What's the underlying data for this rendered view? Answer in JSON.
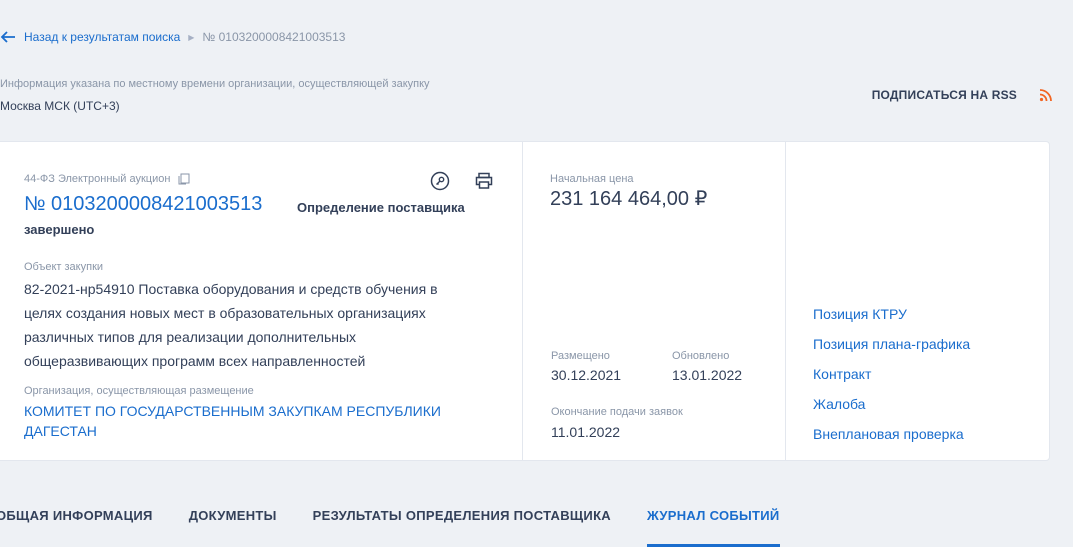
{
  "breadcrumb": {
    "back_label": "Назад к результатам поиска",
    "current": "№ 0103200008421003513"
  },
  "timezone": {
    "note": "Информация указана по местному времени организации, осуществляющей закупку",
    "value": "Москва МСК (UTC+3)"
  },
  "rss": {
    "label": "ПОДПИСАТЬСЯ НА RSS",
    "icon": "rss-icon",
    "color": "#f26522"
  },
  "card": {
    "law": "44-ФЗ Электронный аукцион",
    "reg_number": "№ 0103200008421003513",
    "status_line1": "Определение поставщика",
    "status_line2": "завершено",
    "object_label": "Объект закупки",
    "object_text": "82-2021-нр54910 Поставка оборудования и средств обучения в целях создания новых мест в образовательных организациях различных типов для реализации дополнительных общеразвивающих программ всех направленностей",
    "org_label": "Организация, осуществляющая размещение",
    "org_name": "КОМИТЕТ ПО ГОСУДАРСТВЕННЫМ ЗАКУПКАМ РЕСПУБЛИКИ ДАГЕСТАН",
    "price_label": "Начальная цена",
    "price": "231 164 464,00 ₽",
    "placed_label": "Размещено",
    "placed_date": "30.12.2021",
    "updated_label": "Обновлено",
    "updated_date": "13.01.2022",
    "end_label": "Окончание подачи заявок",
    "end_date": "11.01.2022",
    "links": [
      "Позиция КТРУ",
      "Позиция плана-графика",
      "Контракт",
      "Жалоба",
      "Внеплановая проверка"
    ]
  },
  "tabs": [
    {
      "label": "ОБЩАЯ ИНФОРМАЦИЯ",
      "active": false
    },
    {
      "label": "ДОКУМЕНТЫ",
      "active": false
    },
    {
      "label": "РЕЗУЛЬТАТЫ ОПРЕДЕЛЕНИЯ ПОСТАВЩИКА",
      "active": false
    },
    {
      "label": "ЖУРНАЛ СОБЫТИЙ",
      "active": true
    }
  ],
  "colors": {
    "accent": "#1a6dcd",
    "text": "#334059",
    "muted": "#8a96a8",
    "background": "#eef1f5"
  }
}
